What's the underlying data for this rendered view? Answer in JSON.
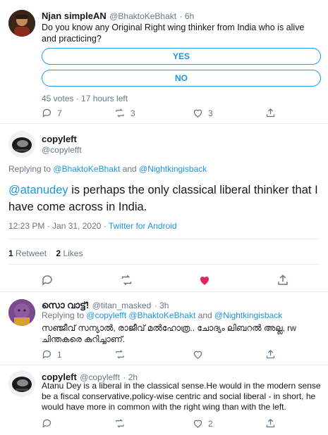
{
  "tweet1": {
    "name": "Njan simpleAN",
    "handle": "@BhaktoKeBhakt",
    "time": "6h",
    "text": "Do you know any Original Right wing thinker from India who is alive and practicing?",
    "poll": {
      "options": [
        "YES",
        "NO"
      ],
      "meta": "45 votes · 17 hours left"
    },
    "replies": "7",
    "retweets": "3",
    "likes": "3"
  },
  "main_tweet": {
    "name": "copyleft",
    "handle": "@copylefft",
    "replying_label": "Replying to",
    "replying_to_1": "@BhaktoKeBhakt",
    "replying_and": "and",
    "replying_to_2": "@Nightkingisback",
    "mention": "@atanudey",
    "text_rest": " is perhaps the only classical liberal thinker that I have come across in India.",
    "timestamp": "12:23 PM · Jan 31, 2020 ·",
    "source": "Twitter for Android",
    "retweet_count": "1",
    "retweet_label": "Retweet",
    "like_count": "2",
    "like_label": "Likes"
  },
  "reply1": {
    "name": "സൊ വാട്ട്!",
    "handle": "@titan_masked",
    "time": "3h",
    "replying_label": "Replying to",
    "replying_to_1": "@copylefft",
    "replying_to_2": "@BhaktoKeBhakt",
    "replying_and": "and",
    "replying_to_3": "@Nightkingisback",
    "text": "സഞ്ജീവ് സന്യാൽ, രാജീവ് മൽഹോത്ര.. ചോദ്യം ലിബറൽ അല്ല, rw ചിന്തകരെ കുറിച്ചാണ്.",
    "replies": "1"
  },
  "reply2": {
    "name": "copyleft",
    "handle": "@copylefft",
    "time": "2h",
    "text": "Atanu Dey is a liberal in the classical sense.He would in the modern sense be a fiscal conservative,policy-wise centric and social liberal - in short, he would have more in common with the right wing than with the left.",
    "likes": "2"
  },
  "colors": {
    "accent": "#1da1f2",
    "link": "#1b95e0",
    "like_red": "#e0245e",
    "muted": "#657786"
  }
}
